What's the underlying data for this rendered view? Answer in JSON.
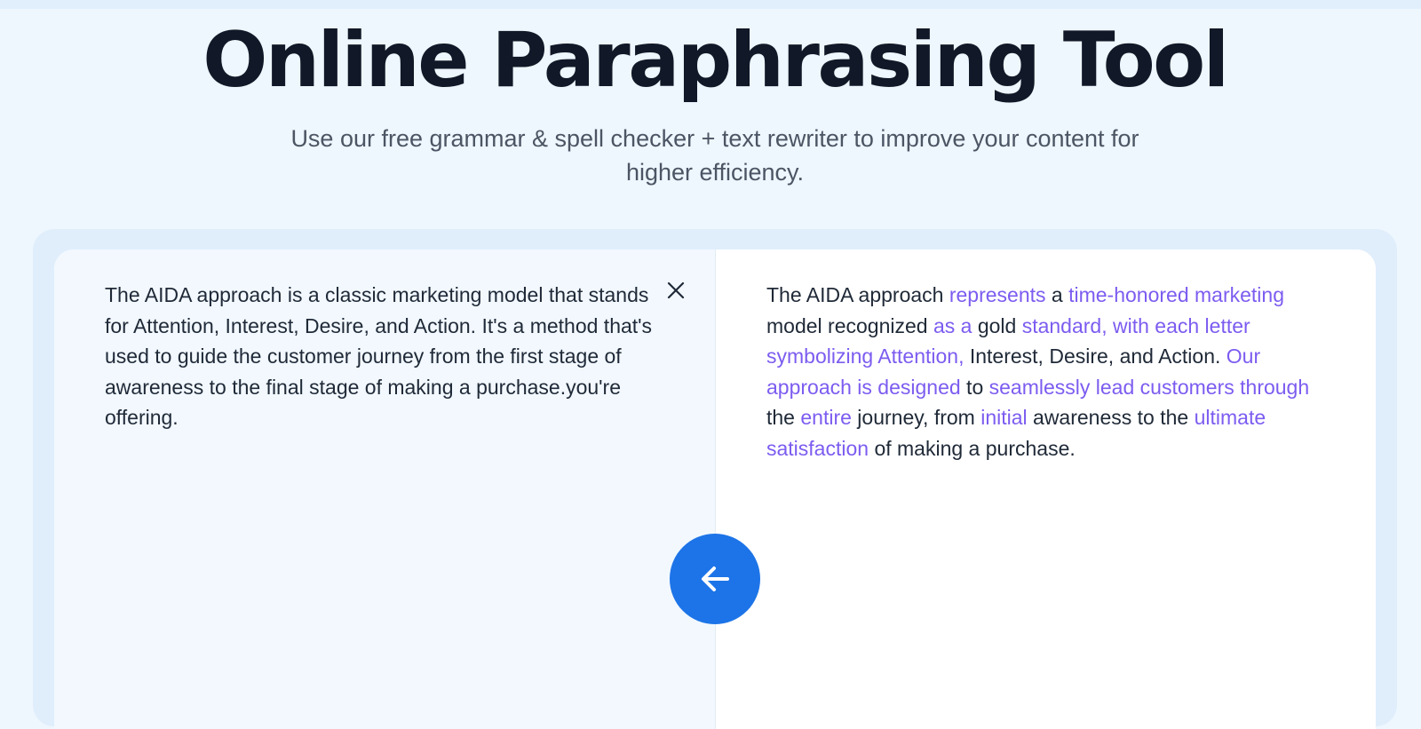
{
  "page": {
    "title": "Online Paraphrasing Tool",
    "subtitle": "Use our free grammar & spell checker + text rewriter to improve your content for higher efficiency."
  },
  "input": {
    "text": "The AIDA approach is a classic marketing model that stands for Attention, Interest, Desire, and Action. It's a method that's used to guide the customer journey from the first stage of awareness to the final stage of making a purchase.you're offering.",
    "clear_icon": "close-icon"
  },
  "output": {
    "segments": [
      {
        "text": "The AIDA approach ",
        "changed": false
      },
      {
        "text": "represents",
        "changed": true
      },
      {
        "text": " a ",
        "changed": false
      },
      {
        "text": "time-honored marketing",
        "changed": true
      },
      {
        "text": " model recognized ",
        "changed": false
      },
      {
        "text": "as a",
        "changed": true
      },
      {
        "text": " gold ",
        "changed": false
      },
      {
        "text": "standard, with each letter symbolizing Attention,",
        "changed": true
      },
      {
        "text": " Interest, Desire, and Action. ",
        "changed": false
      },
      {
        "text": "Our approach is designed",
        "changed": true
      },
      {
        "text": " to ",
        "changed": false
      },
      {
        "text": "seamlessly lead customers through",
        "changed": true
      },
      {
        "text": " the ",
        "changed": false
      },
      {
        "text": "entire",
        "changed": true
      },
      {
        "text": " journey, from ",
        "changed": false
      },
      {
        "text": "initial",
        "changed": true
      },
      {
        "text": " awareness to the ",
        "changed": false
      },
      {
        "text": "ultimate satisfaction",
        "changed": true
      },
      {
        "text": " of making a purchase.",
        "changed": false
      }
    ]
  },
  "swap_button": {
    "icon": "arrow-left-icon"
  },
  "colors": {
    "highlight": "#7c5cf0",
    "button": "#1d74e8",
    "title": "#111827",
    "subtitle": "#4b5563"
  }
}
